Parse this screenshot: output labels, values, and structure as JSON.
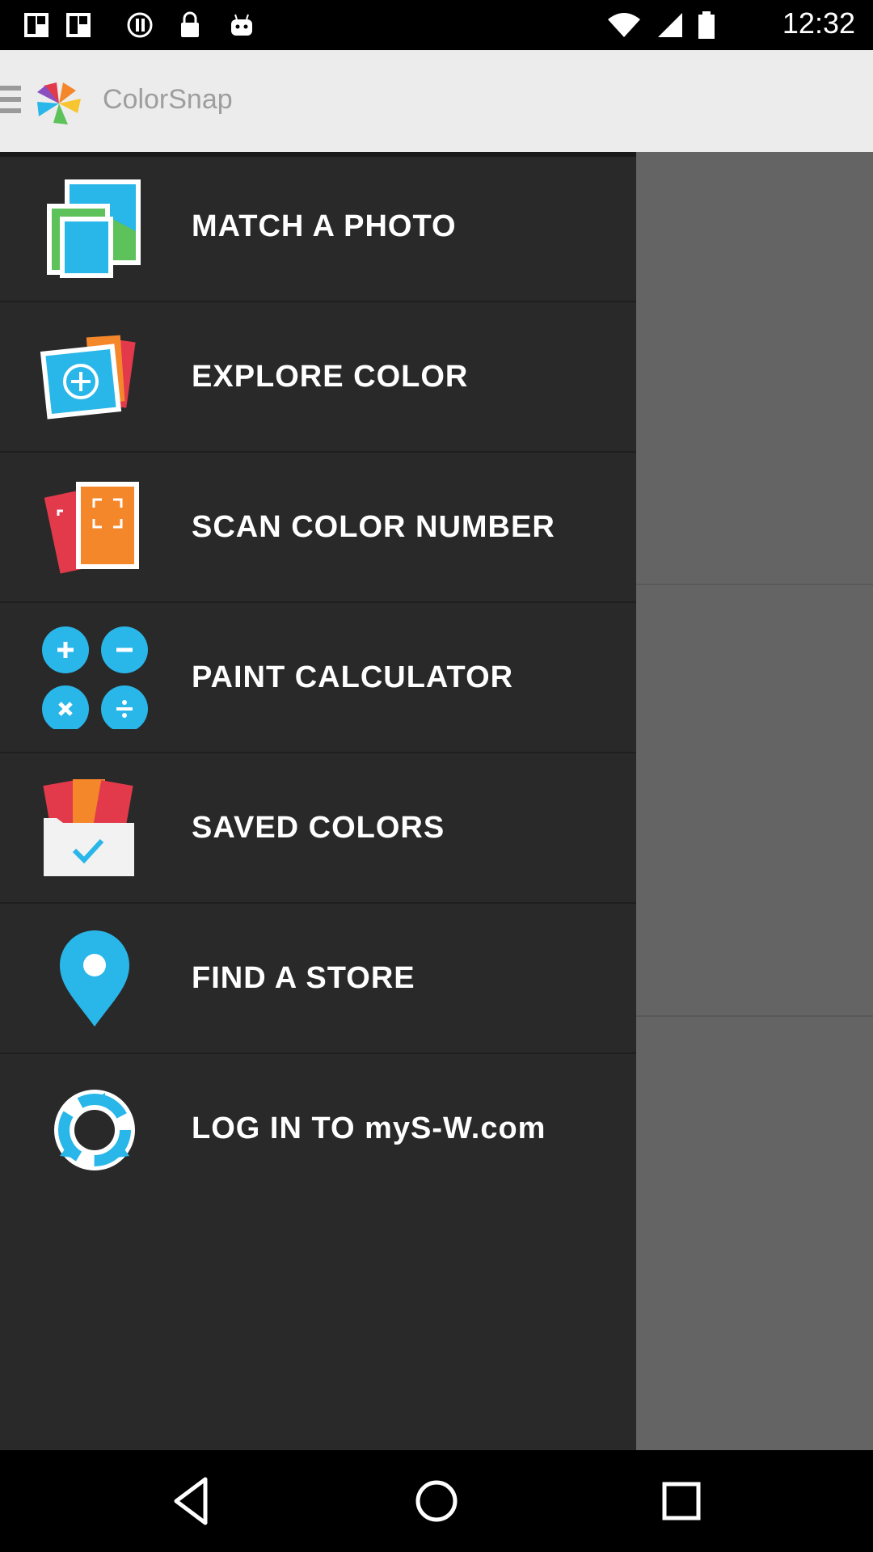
{
  "status_bar": {
    "time": "12:32",
    "icons": [
      "photo-icon",
      "photo-icon",
      "alert-circle-icon",
      "lock-icon",
      "android-icon",
      "wifi-icon",
      "signal-icon",
      "battery-icon"
    ]
  },
  "app_bar": {
    "title": "ColorSnap",
    "menu_icon": "hamburger-icon",
    "logo_icon": "colorsnap-logo-icon"
  },
  "drawer": {
    "items": [
      {
        "label": "MATCH A PHOTO",
        "icon": "match-photo-icon"
      },
      {
        "label": "EXPLORE COLOR",
        "icon": "explore-color-icon"
      },
      {
        "label": "SCAN COLOR NUMBER",
        "icon": "scan-color-icon"
      },
      {
        "label": "PAINT CALCULATOR",
        "icon": "paint-calculator-icon"
      },
      {
        "label": "SAVED COLORS",
        "icon": "saved-colors-icon"
      },
      {
        "label": "FIND A STORE",
        "icon": "location-pin-icon"
      },
      {
        "label": "LOG IN TO myS-W.com",
        "icon": "login-sync-icon"
      }
    ]
  },
  "nav_bar": {
    "buttons": [
      "back-icon",
      "home-icon",
      "recents-icon"
    ]
  },
  "colors": {
    "drawer_bg": "#292929",
    "app_bar_bg": "#ececec",
    "accent_blue": "#29b6e8",
    "accent_green": "#5ec25b",
    "accent_orange": "#f5872b",
    "accent_red": "#e23a4b"
  }
}
